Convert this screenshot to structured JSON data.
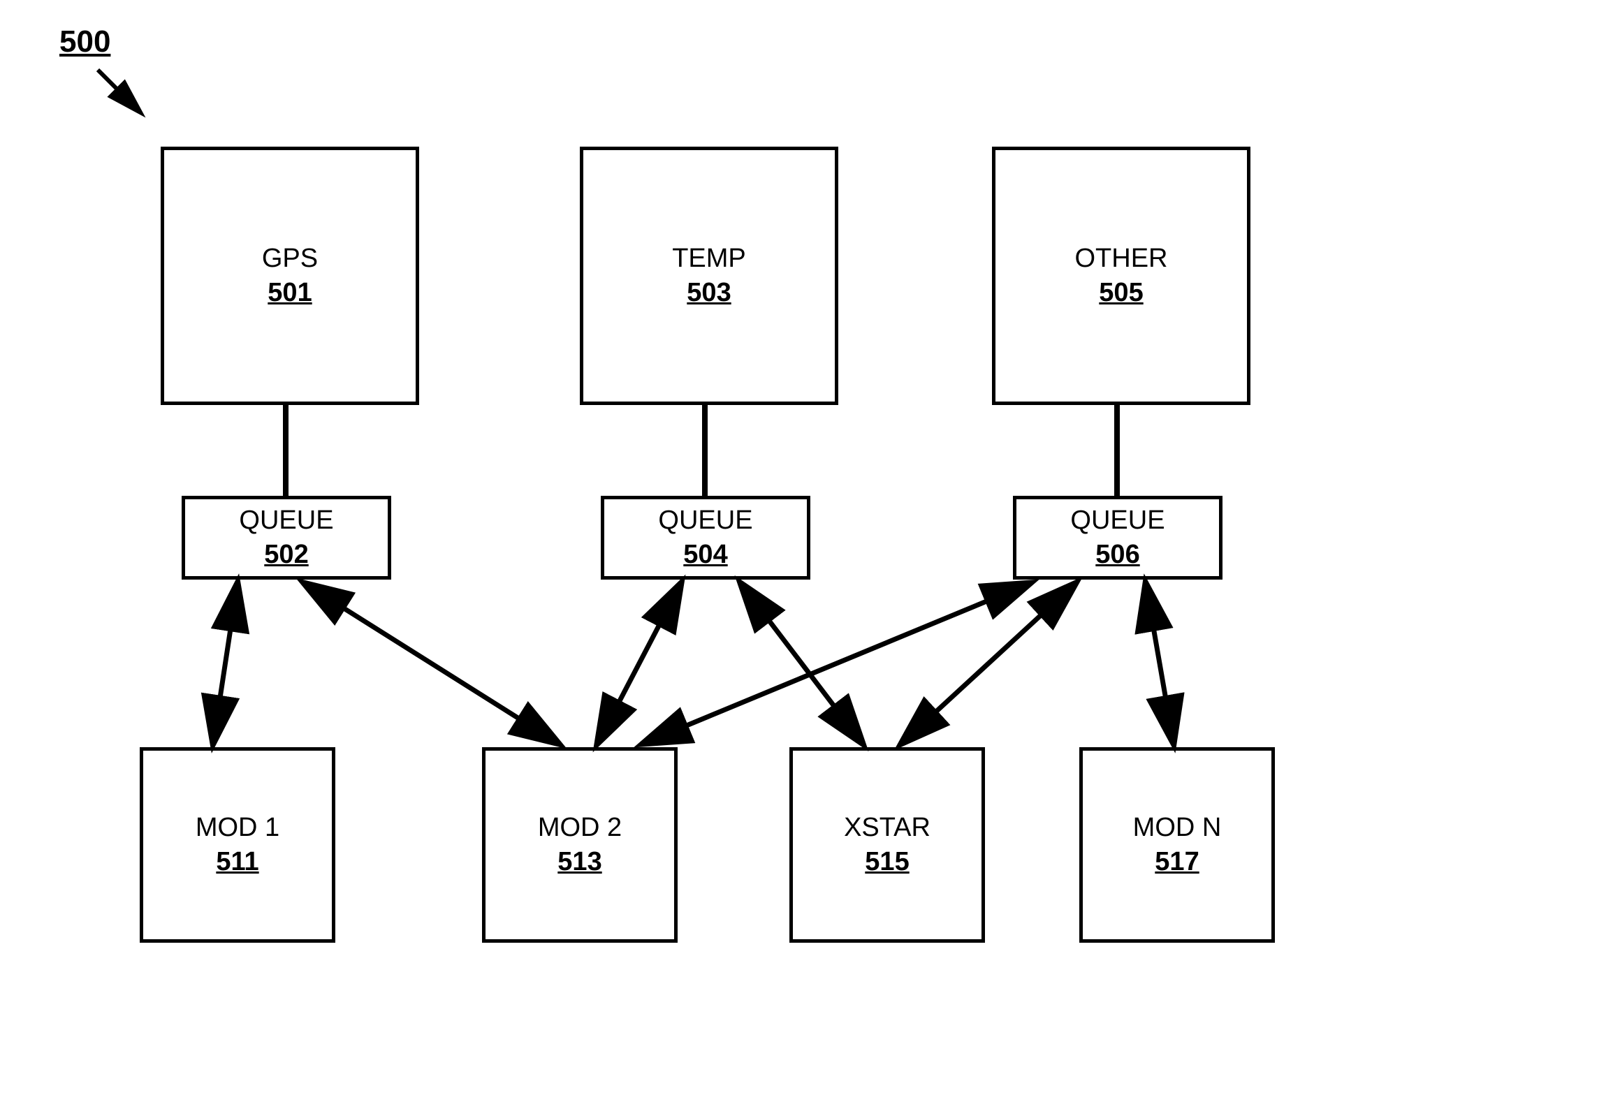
{
  "figure_number": "500",
  "top_boxes": [
    {
      "label": "GPS",
      "number": "501"
    },
    {
      "label": "TEMP",
      "number": "503"
    },
    {
      "label": "OTHER",
      "number": "505"
    }
  ],
  "queues": [
    {
      "label": "QUEUE",
      "number": "502"
    },
    {
      "label": "QUEUE",
      "number": "504"
    },
    {
      "label": "QUEUE",
      "number": "506"
    }
  ],
  "bottom_boxes": [
    {
      "label": "MOD 1",
      "number": "511"
    },
    {
      "label": "MOD 2",
      "number": "513"
    },
    {
      "label": "XSTAR",
      "number": "515"
    },
    {
      "label": "MOD N",
      "number": "517"
    }
  ]
}
